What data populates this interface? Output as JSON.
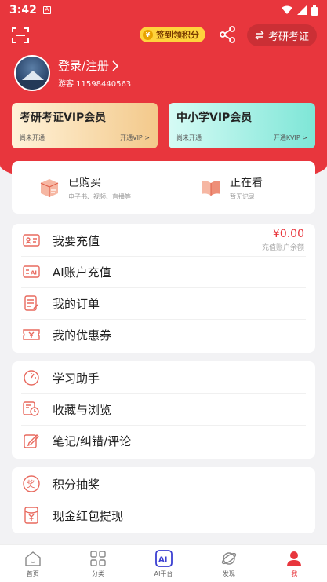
{
  "status": {
    "time": "3:42"
  },
  "header": {
    "checkin_label": "签到领积分",
    "coin_symbol": "¥",
    "exam_switch_label": "考研考证"
  },
  "profile": {
    "login_label": "登录/注册",
    "guest_id": "游客 11598440563"
  },
  "vip": [
    {
      "title": "考研考证VIP会员",
      "status": "尚未开通",
      "action": "开通VIP >"
    },
    {
      "title": "中小学VIP会员",
      "status": "尚未开通",
      "action": "开通KVIP >"
    }
  ],
  "purchased": {
    "bought_title": "已购买",
    "bought_sub": "电子书、视频、直播等",
    "watching_title": "正在看",
    "watching_sub": "暂无记录"
  },
  "menu_group1": {
    "recharge": "我要充值",
    "balance_amount": "¥0.00",
    "balance_label": "充值账户余额",
    "ai_recharge": "AI账户充值",
    "orders": "我的订单",
    "coupons": "我的优惠券"
  },
  "menu_group2": {
    "assistant": "学习助手",
    "favorites": "收藏与浏览",
    "notes": "笔记/纠错/评论"
  },
  "menu_group3": {
    "lottery": "积分抽奖",
    "cash_withdraw": "现金红包提现"
  },
  "icons": {
    "ai_badge": "AI",
    "lottery_char": "奖"
  },
  "nav": {
    "home": "首页",
    "category": "分类",
    "ai": "AI平台",
    "discover": "发现",
    "me": "我"
  },
  "colors": {
    "brand_red": "#e8363d",
    "checkin_yellow": "#ffd33d"
  }
}
